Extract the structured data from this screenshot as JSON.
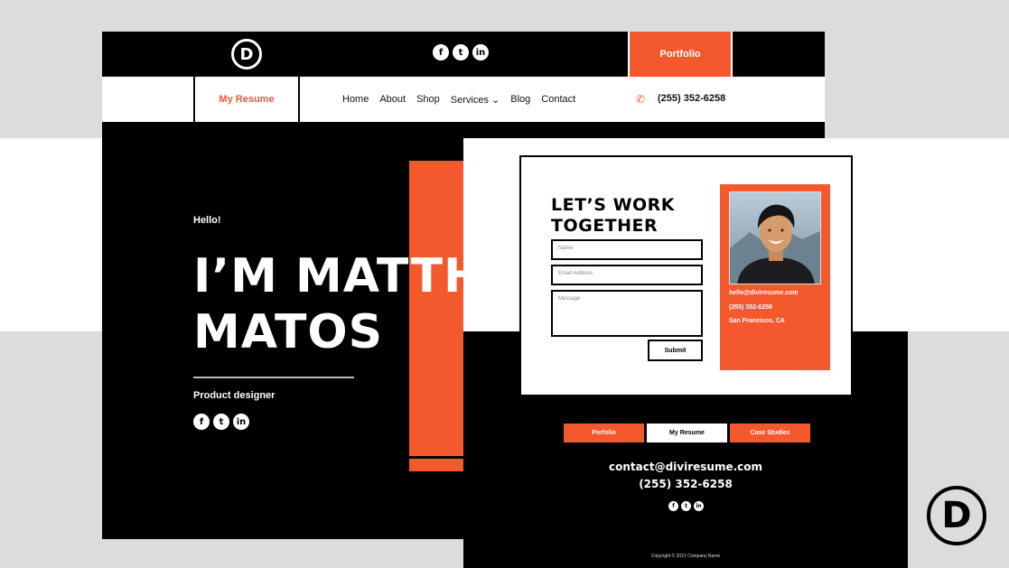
{
  "colors": {
    "accent": "#f4592e",
    "dark": "#000000",
    "light": "#ffffff",
    "background": "#dcdcdc"
  },
  "back_window": {
    "logo_letter": "D",
    "social": [
      {
        "icon": "facebook-icon",
        "glyph": "f"
      },
      {
        "icon": "twitter-icon",
        "glyph": "t"
      },
      {
        "icon": "linkedin-icon",
        "glyph": "in"
      }
    ],
    "portfolio_label": "Portfolio",
    "my_resume_label": "My Resume",
    "nav": [
      "Home",
      "About",
      "Shop",
      "Services ⌄",
      "Blog",
      "Contact"
    ],
    "phone": "(255) 352-6258",
    "hero": {
      "greeting": "Hello!",
      "name_line1": "I’M MATTH",
      "name_line2": "MATOS",
      "role": "Product designer"
    }
  },
  "front_window": {
    "heading_line1": "LET’S WORK",
    "heading_line2": "TOGETHER",
    "form": {
      "name_placeholder": "Name",
      "email_placeholder": "Email Address",
      "message_placeholder": "Message",
      "submit_label": "Submit"
    },
    "profile": {
      "email": "hello@diviresume.com",
      "phone": "(255) 352-6258",
      "location": "San Francisco, CA"
    },
    "footer_buttons": [
      "Porfolio",
      "My Resume",
      "Case Studies"
    ],
    "contact_email": "contact@diviresume.com",
    "contact_phone": "(255) 352-6258",
    "copyright": "Copyright © 2021 Company Name"
  },
  "brand_logo_letter": "D"
}
